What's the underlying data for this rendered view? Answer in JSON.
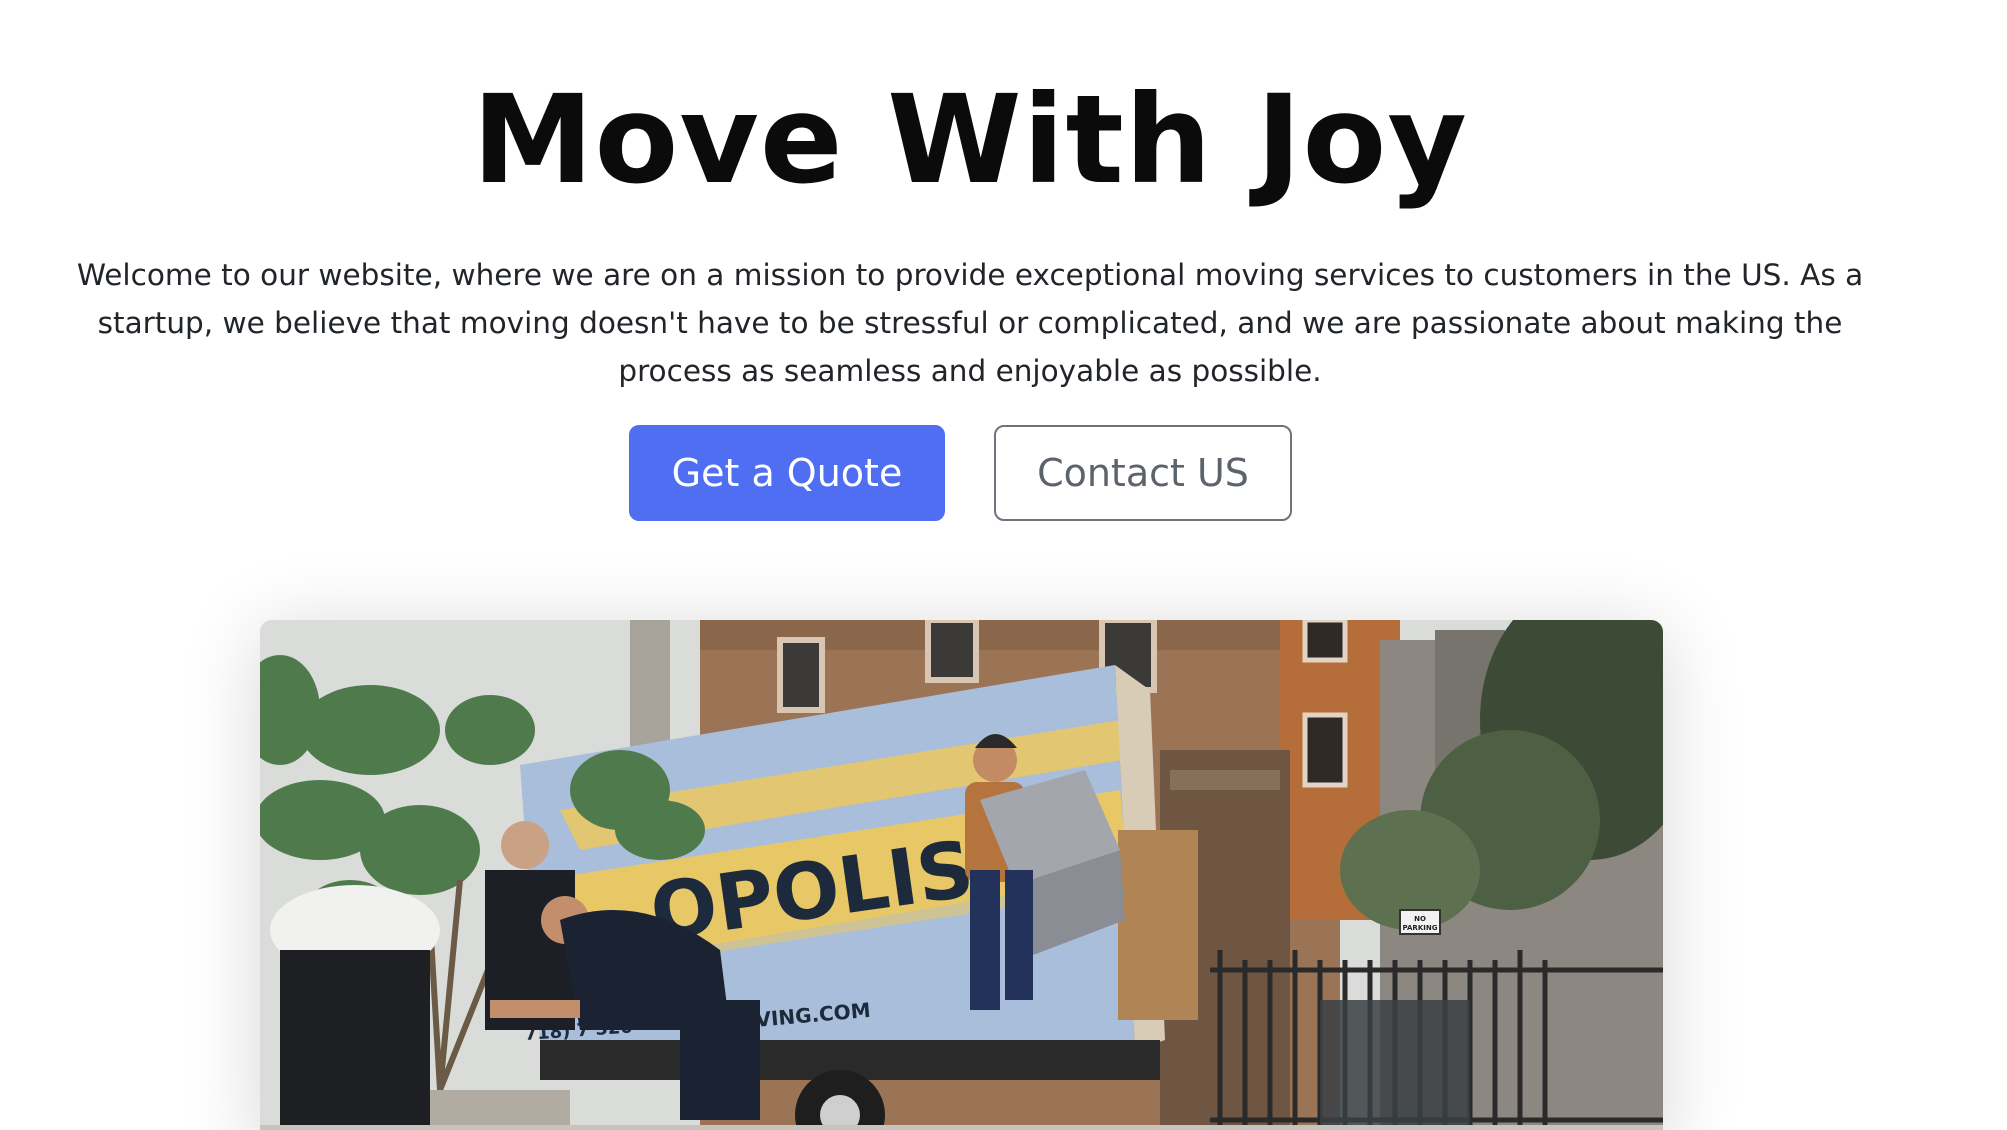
{
  "hero": {
    "title": "Move With Joy",
    "intro": "Welcome to our website, where we are on a mission to provide exceptional moving services to customers in the US. As a startup, we believe that moving doesn't have to be stressful or complicated, and we are passionate about making the process as seamless and enjoyable as possible."
  },
  "buttons": {
    "quote_label": "Get a Quote",
    "contact_label": "Contact US"
  },
  "photo": {
    "truck_brand": "OPOLIS",
    "truck_sub": "G",
    "truck_phone": "718) 7  520 • ",
    "truck_url": "MOVING.COM",
    "sign": "NO PARKING"
  },
  "colors": {
    "accent": "#4f6ef2",
    "outline": "#6c757d",
    "truck_blue": "#a9bedb",
    "truck_yellow": "#e8c766"
  }
}
